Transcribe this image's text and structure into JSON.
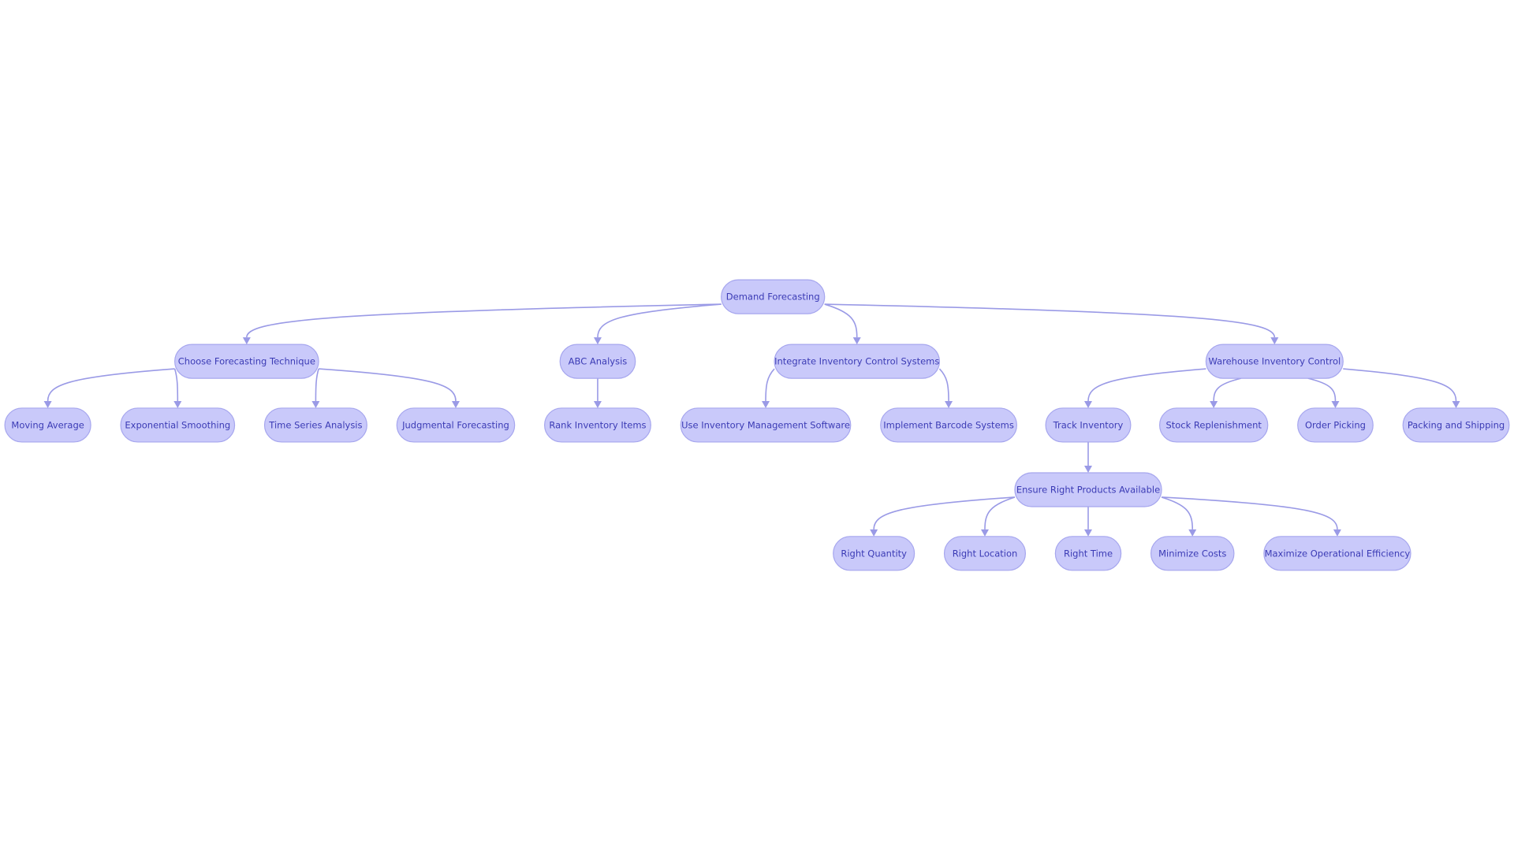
{
  "flowchart": {
    "colors": {
      "node_fill": "#c9c9fa",
      "node_stroke": "#a6a6ee",
      "text": "#3b3bb5",
      "edge": "#9a9ae6"
    },
    "nodes": [
      {
        "id": "root",
        "label": "Demand Forecasting",
        "parent": null
      },
      {
        "id": "cft",
        "label": "Choose Forecasting Technique",
        "parent": "root"
      },
      {
        "id": "abc",
        "label": "ABC Analysis",
        "parent": "root"
      },
      {
        "id": "iics",
        "label": "Integrate Inventory Control Systems",
        "parent": "root"
      },
      {
        "id": "wic",
        "label": "Warehouse Inventory Control",
        "parent": "root"
      },
      {
        "id": "ma",
        "label": "Moving Average",
        "parent": "cft"
      },
      {
        "id": "es",
        "label": "Exponential Smoothing",
        "parent": "cft"
      },
      {
        "id": "tsa",
        "label": "Time Series Analysis",
        "parent": "cft"
      },
      {
        "id": "jf",
        "label": "Judgmental Forecasting",
        "parent": "cft"
      },
      {
        "id": "rii",
        "label": "Rank Inventory Items",
        "parent": "abc"
      },
      {
        "id": "uims",
        "label": "Use Inventory Management Software",
        "parent": "iics"
      },
      {
        "id": "ibs",
        "label": "Implement Barcode Systems",
        "parent": "iics"
      },
      {
        "id": "ti",
        "label": "Track Inventory",
        "parent": "wic"
      },
      {
        "id": "sr",
        "label": "Stock Replenishment",
        "parent": "wic"
      },
      {
        "id": "op",
        "label": "Order Picking",
        "parent": "wic"
      },
      {
        "id": "ps",
        "label": "Packing and Shipping",
        "parent": "wic"
      },
      {
        "id": "erpa",
        "label": "Ensure Right Products Available",
        "parent": "ti"
      },
      {
        "id": "rq",
        "label": "Right Quantity",
        "parent": "erpa"
      },
      {
        "id": "rl",
        "label": "Right Location",
        "parent": "erpa"
      },
      {
        "id": "rt",
        "label": "Right Time",
        "parent": "erpa"
      },
      {
        "id": "mc",
        "label": "Minimize Costs",
        "parent": "erpa"
      },
      {
        "id": "moe",
        "label": "Maximize Operational Efficiency",
        "parent": "erpa"
      }
    ]
  }
}
